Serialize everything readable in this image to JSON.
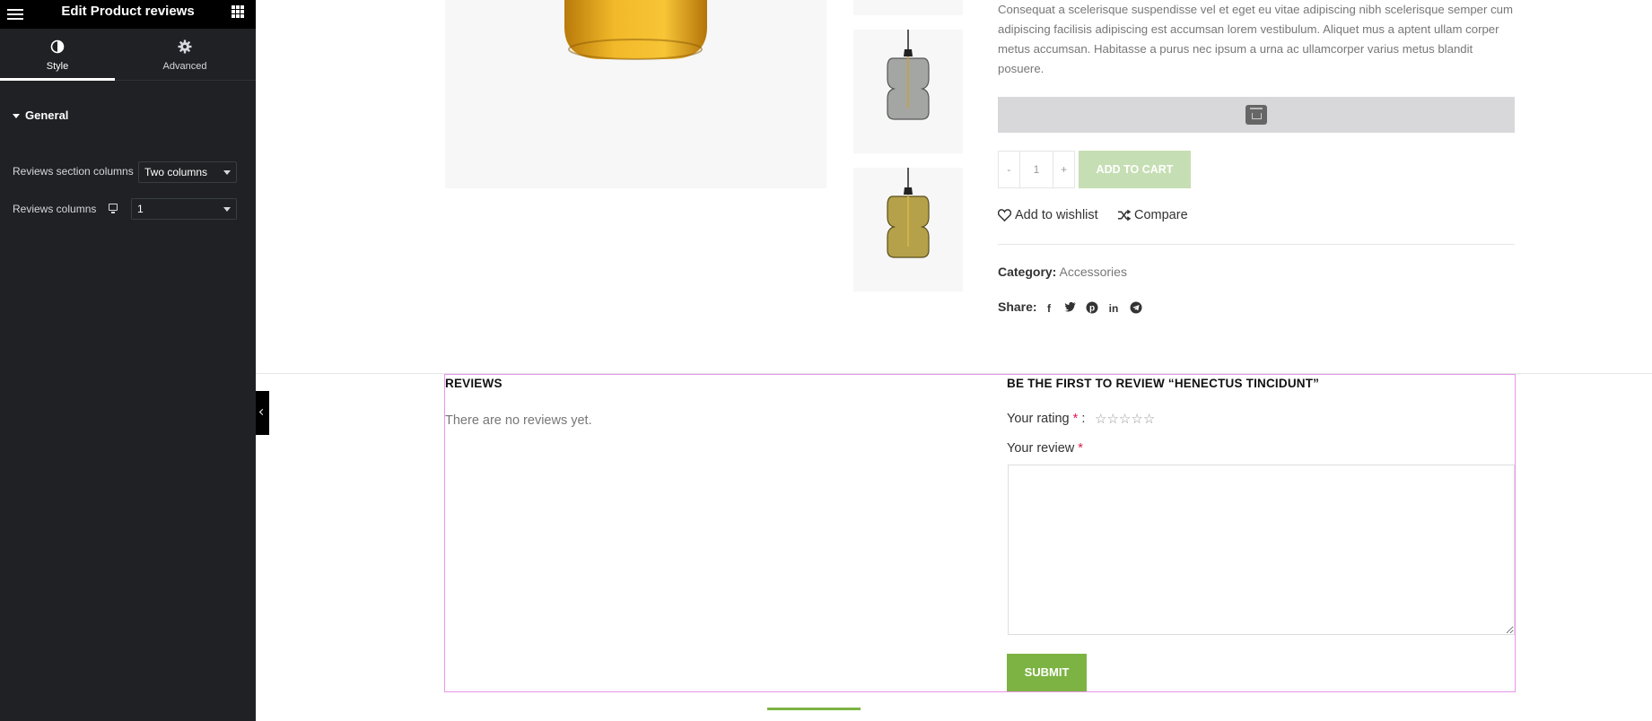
{
  "editor": {
    "title": "Edit Product reviews",
    "tabs": [
      {
        "label": "Style",
        "icon": "contrast-icon",
        "active": true
      },
      {
        "label": "Advanced",
        "icon": "gear-icon",
        "active": false
      }
    ],
    "section": "General",
    "controls": {
      "section_columns": {
        "label": "Reviews section columns",
        "value": "Two columns"
      },
      "columns": {
        "label": "Reviews columns",
        "value": "1",
        "device_icon": "desktop-icon"
      }
    }
  },
  "product": {
    "description": "Consequat a scelerisque suspendisse vel et eget eu vitae adipiscing nibh scelerisque semper cum adipiscing facilisis adipiscing est accumsan lorem vestibulum. Aliquet mus a aptent ullam corper metus accumsan. Habitasse a purus nec ipsum a urna ac ullamcorper varius metus blandit posuere.",
    "qty_minus": "-",
    "qty_value": "1",
    "qty_plus": "+",
    "add_to_cart": "ADD TO CART",
    "wishlist": "Add to wishlist",
    "compare": "Compare",
    "category_label": "Category:",
    "category_value": "Accessories",
    "share_label": "Share:",
    "share_icons": [
      "facebook-icon",
      "twitter-icon",
      "pinterest-icon",
      "linkedin-icon",
      "telegram-icon"
    ]
  },
  "reviews": {
    "title": "REVIEWS",
    "empty": "There are no reviews yet.",
    "form_title": "BE THE FIRST TO REVIEW “HENECTUS TINCIDUNT”",
    "rating_label": "Your rating",
    "rating_required": "*",
    "rating_colon": ":",
    "review_label": "Your review",
    "review_required": "*",
    "submit": "SUBMIT",
    "accent_color": "#7cb342"
  }
}
